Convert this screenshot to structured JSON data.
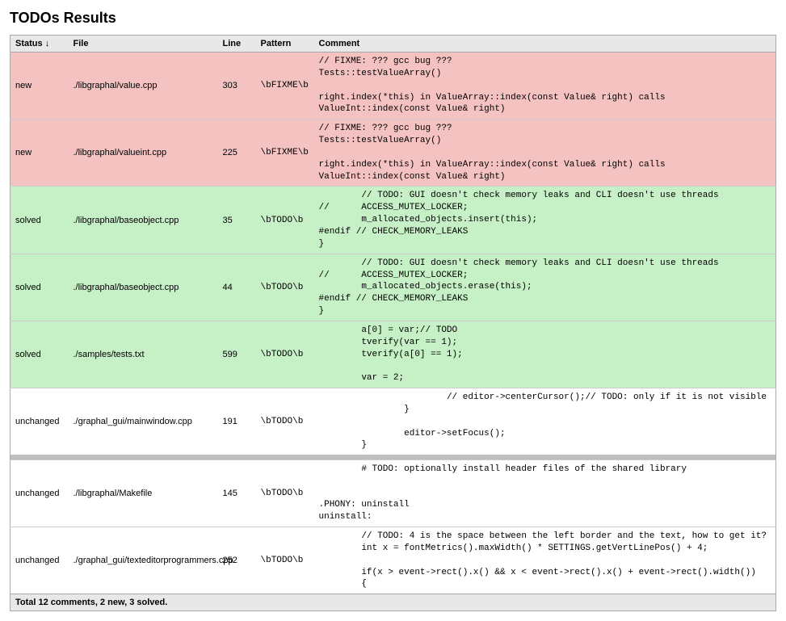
{
  "title": "TODOs Results",
  "columns": {
    "status": "Status",
    "sort_indicator": "↓",
    "file": "File",
    "line": "Line",
    "pattern": "Pattern",
    "comment": "Comment"
  },
  "rows": [
    {
      "status": "new",
      "file": "./libgraphal/value.cpp",
      "line": "303",
      "pattern": "\\bFIXME\\b",
      "comment": "// FIXME: ??? gcc bug ???\nTests::testValueArray()\n\nright.index(*this) in ValueArray::index(const Value& right) calls\nValueInt::index(const Value& right)"
    },
    {
      "status": "new",
      "file": "./libgraphal/valueint.cpp",
      "line": "225",
      "pattern": "\\bFIXME\\b",
      "comment": "// FIXME: ??? gcc bug ???\nTests::testValueArray()\n\nright.index(*this) in ValueArray::index(const Value& right) calls\nValueInt::index(const Value& right)"
    },
    {
      "status": "solved",
      "file": "./libgraphal/baseobject.cpp",
      "line": "35",
      "pattern": "\\bTODO\\b",
      "comment": "        // TODO: GUI doesn't check memory leaks and CLI doesn't use threads\n//      ACCESS_MUTEX_LOCKER;\n        m_allocated_objects.insert(this);\n#endif // CHECK_MEMORY_LEAKS\n}"
    },
    {
      "status": "solved",
      "file": "./libgraphal/baseobject.cpp",
      "line": "44",
      "pattern": "\\bTODO\\b",
      "comment": "        // TODO: GUI doesn't check memory leaks and CLI doesn't use threads\n//      ACCESS_MUTEX_LOCKER;\n        m_allocated_objects.erase(this);\n#endif // CHECK_MEMORY_LEAKS\n}"
    },
    {
      "status": "solved",
      "file": "./samples/tests.txt",
      "line": "599",
      "pattern": "\\bTODO\\b",
      "comment": "        a[0] = var;// TODO\n        tverify(var == 1);\n        tverify(a[0] == 1);\n\n        var = 2;"
    },
    {
      "status": "unchanged",
      "file": "./graphal_gui/mainwindow.cpp",
      "line": "191",
      "pattern": "\\bTODO\\b",
      "comment": "                        // editor->centerCursor();// TODO: only if it is not visible\n                }\n\n                editor->setFocus();\n        }"
    },
    {
      "gap": true
    },
    {
      "status": "unchanged",
      "file": "./libgraphal/Makefile",
      "line": "145",
      "pattern": "\\bTODO\\b",
      "comment": "        # TODO: optionally install header files of the shared library\n\n\n.PHONY: uninstall\nuninstall:"
    },
    {
      "status": "unchanged",
      "file": "./graphal_gui/texteditorprogrammers.cpp",
      "line": "252",
      "pattern": "\\bTODO\\b",
      "comment": "        // TODO: 4 is the space between the left border and the text, how to get it?\n        int x = fontMetrics().maxWidth() * SETTINGS.getVertLinePos() + 4;\n\n        if(x > event->rect().x() && x < event->rect().x() + event->rect().width())\n        {"
    }
  ],
  "footer": "Total 12 comments, 2 new, 3 solved."
}
